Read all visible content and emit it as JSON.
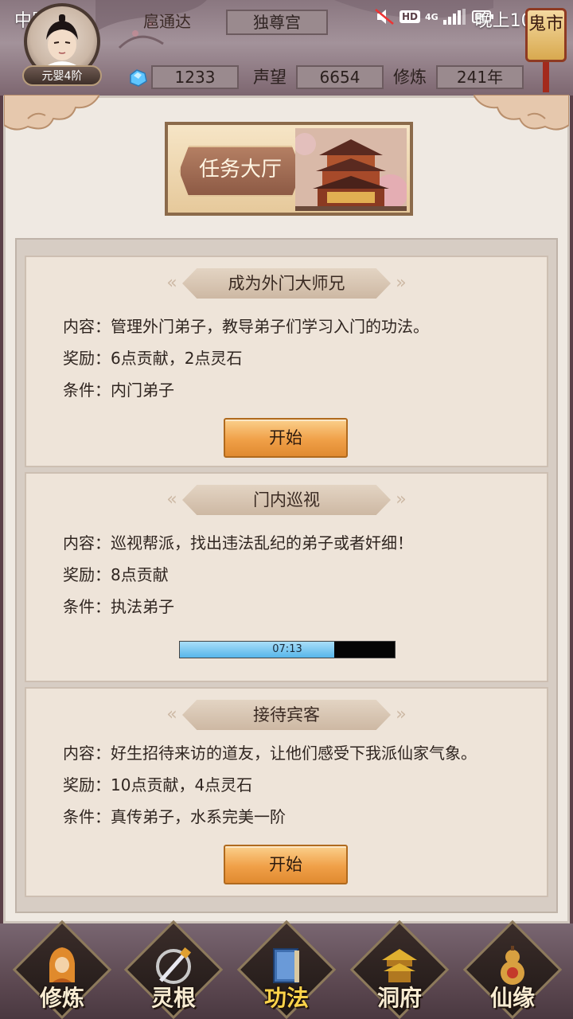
{
  "status_bar": {
    "carrier": "中国移动",
    "time": "晚上10:41",
    "network": "4G",
    "hd": "HD"
  },
  "player": {
    "rank": "元婴4阶",
    "name": "扈通达",
    "sect": "独尊宫",
    "spirit_stones": "1233",
    "reputation_label": "声望",
    "reputation": "6654",
    "cultivation_label": "修炼",
    "cultivation": "241年"
  },
  "ghost_market": {
    "label": "鬼市"
  },
  "hall": {
    "title": "任务大厅"
  },
  "tasks": [
    {
      "title": "成为外门大师兄",
      "content": "内容：管理外门弟子，教导弟子们学习入门的功法。",
      "reward": "奖励：6点贡献，2点灵石",
      "condition": "条件：内门弟子",
      "button": "开始"
    },
    {
      "title": "门内巡视",
      "content": "内容：巡视帮派，找出违法乱纪的弟子或者奸细！",
      "reward": "奖励：8点贡献",
      "condition": "条件：执法弟子",
      "timer": "07:13",
      "progress": 0.72
    },
    {
      "title": "接待宾客",
      "content": "内容：好生招待来访的道友，让他们感受下我派仙家气象。",
      "reward": "奖励：10点贡献，4点灵石",
      "condition": "条件：真传弟子，水系完美一阶",
      "button": "开始"
    }
  ],
  "nav": [
    {
      "label": "修炼",
      "icon": "monk-icon"
    },
    {
      "label": "灵根",
      "icon": "sword-icon"
    },
    {
      "label": "功法",
      "icon": "book-icon"
    },
    {
      "label": "洞府",
      "icon": "pavilion-icon"
    },
    {
      "label": "仙缘",
      "icon": "gourd-icon"
    }
  ],
  "colors": {
    "accent": "#f0a048",
    "panel_bg": "#efe9e2",
    "progress": "#58b6ea"
  }
}
